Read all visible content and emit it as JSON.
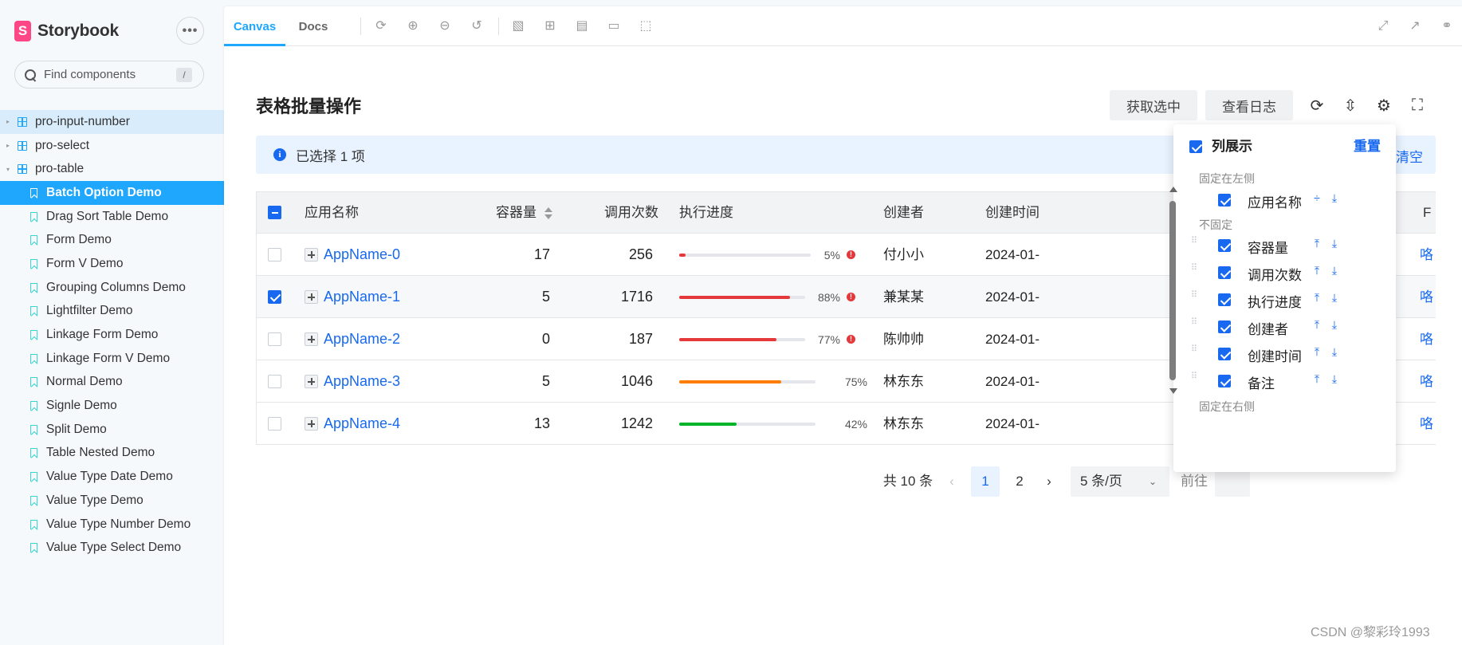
{
  "sidebar": {
    "brand": "Storybook",
    "more_label": "•••",
    "search_placeholder": "Find components",
    "search_shortcut": "/",
    "groups": [
      {
        "label": "pro-input-number",
        "expanded": false
      },
      {
        "label": "pro-select",
        "expanded": false
      },
      {
        "label": "pro-table",
        "expanded": true
      }
    ],
    "stories": [
      "Batch Option Demo",
      "Drag Sort Table Demo",
      "Form Demo",
      "Form V Demo",
      "Grouping Columns Demo",
      "Lightfilter Demo",
      "Linkage Form Demo",
      "Linkage Form V Demo",
      "Normal Demo",
      "Signle Demo",
      "Split Demo",
      "Table Nested Demo",
      "Value Type Date Demo",
      "Value Type Demo",
      "Value Type Number Demo",
      "Value Type Select Demo"
    ],
    "selected_story": "Batch Option Demo"
  },
  "toolbar": {
    "tabs": [
      "Canvas",
      "Docs"
    ],
    "active_tab": "Canvas",
    "left_icons": [
      "sync-icon",
      "zoom-in-icon",
      "zoom-out-icon",
      "zoom-reset-icon",
      "image-icon",
      "grid-icon",
      "component-icon",
      "ruler-icon",
      "outline-icon"
    ],
    "right_icons": [
      "fullscreen-icon",
      "share-icon",
      "link-icon"
    ]
  },
  "page": {
    "title": "表格批量操作",
    "btn_get_selected": "获取选中",
    "btn_view_log": "查看日志",
    "alert_text": "已选择  1  项",
    "alert_clear": "清空",
    "columns": {
      "name": "应用名称",
      "capacity": "容器量",
      "calls": "调用次数",
      "progress": "执行进度",
      "creator": "创建者",
      "created_at": "创建时间",
      "ops": "F"
    },
    "rows": [
      {
        "name": "AppName-0",
        "capacity": "17",
        "calls": "256",
        "progress": 5,
        "progress_text": "5%",
        "status": "error",
        "creator": "付小小",
        "created_at": "2024-01-",
        "op": "咯",
        "checked": false
      },
      {
        "name": "AppName-1",
        "capacity": "5",
        "calls": "1716",
        "progress": 88,
        "progress_text": "88%",
        "status": "error",
        "creator": "兼某某",
        "created_at": "2024-01-",
        "op": "咯",
        "checked": true
      },
      {
        "name": "AppName-2",
        "capacity": "0",
        "calls": "187",
        "progress": 77,
        "progress_text": "77%",
        "status": "error",
        "creator": "陈帅帅",
        "created_at": "2024-01-",
        "op": "咯",
        "checked": false
      },
      {
        "name": "AppName-3",
        "capacity": "5",
        "calls": "1046",
        "progress": 75,
        "progress_text": "75%",
        "status": "normal",
        "creator": "林东东",
        "created_at": "2024-01-",
        "op": "咯",
        "checked": false
      },
      {
        "name": "AppName-4",
        "capacity": "13",
        "calls": "1242",
        "progress": 42,
        "progress_text": "42%",
        "status": "success",
        "creator": "林东东",
        "created_at": "2024-01-",
        "op": "咯",
        "checked": false
      }
    ],
    "pagination": {
      "total": "共 10 条",
      "prev": "‹",
      "pages": [
        "1",
        "2"
      ],
      "current": "1",
      "next": "›",
      "page_size": "5 条/页",
      "goto": "前往"
    }
  },
  "column_settings": {
    "title": "列展示",
    "reset": "重置",
    "group_left": "固定在左侧",
    "group_none": "不固定",
    "group_cut": "固定在右侧",
    "fixed_left": [
      "应用名称"
    ],
    "unfixed": [
      "容器量",
      "调用次数",
      "执行进度",
      "创建者",
      "创建时间",
      "备注"
    ]
  },
  "colors": {
    "accent": "#1869f0",
    "storybook_blue": "#1ea7fd",
    "error": "#e5383b",
    "active_progress": "#ff7d00",
    "success": "#00b42a"
  },
  "watermark": "CSDN @黎彩玲1993"
}
